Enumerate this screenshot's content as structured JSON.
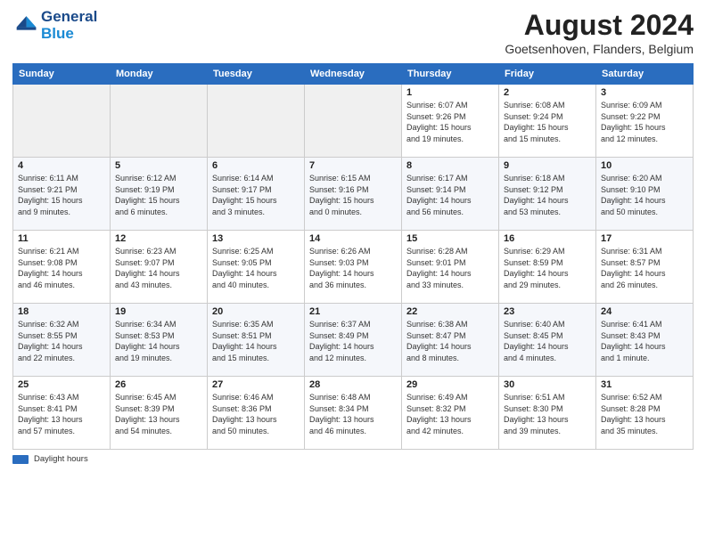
{
  "logo": {
    "line1": "General",
    "line2": "Blue"
  },
  "title": "August 2024",
  "location": "Goetsenhoven, Flanders, Belgium",
  "days_of_week": [
    "Sunday",
    "Monday",
    "Tuesday",
    "Wednesday",
    "Thursday",
    "Friday",
    "Saturday"
  ],
  "footer_label": "Daylight hours",
  "weeks": [
    [
      {
        "day": "",
        "info": ""
      },
      {
        "day": "",
        "info": ""
      },
      {
        "day": "",
        "info": ""
      },
      {
        "day": "",
        "info": ""
      },
      {
        "day": "1",
        "info": "Sunrise: 6:07 AM\nSunset: 9:26 PM\nDaylight: 15 hours\nand 19 minutes."
      },
      {
        "day": "2",
        "info": "Sunrise: 6:08 AM\nSunset: 9:24 PM\nDaylight: 15 hours\nand 15 minutes."
      },
      {
        "day": "3",
        "info": "Sunrise: 6:09 AM\nSunset: 9:22 PM\nDaylight: 15 hours\nand 12 minutes."
      }
    ],
    [
      {
        "day": "4",
        "info": "Sunrise: 6:11 AM\nSunset: 9:21 PM\nDaylight: 15 hours\nand 9 minutes."
      },
      {
        "day": "5",
        "info": "Sunrise: 6:12 AM\nSunset: 9:19 PM\nDaylight: 15 hours\nand 6 minutes."
      },
      {
        "day": "6",
        "info": "Sunrise: 6:14 AM\nSunset: 9:17 PM\nDaylight: 15 hours\nand 3 minutes."
      },
      {
        "day": "7",
        "info": "Sunrise: 6:15 AM\nSunset: 9:16 PM\nDaylight: 15 hours\nand 0 minutes."
      },
      {
        "day": "8",
        "info": "Sunrise: 6:17 AM\nSunset: 9:14 PM\nDaylight: 14 hours\nand 56 minutes."
      },
      {
        "day": "9",
        "info": "Sunrise: 6:18 AM\nSunset: 9:12 PM\nDaylight: 14 hours\nand 53 minutes."
      },
      {
        "day": "10",
        "info": "Sunrise: 6:20 AM\nSunset: 9:10 PM\nDaylight: 14 hours\nand 50 minutes."
      }
    ],
    [
      {
        "day": "11",
        "info": "Sunrise: 6:21 AM\nSunset: 9:08 PM\nDaylight: 14 hours\nand 46 minutes."
      },
      {
        "day": "12",
        "info": "Sunrise: 6:23 AM\nSunset: 9:07 PM\nDaylight: 14 hours\nand 43 minutes."
      },
      {
        "day": "13",
        "info": "Sunrise: 6:25 AM\nSunset: 9:05 PM\nDaylight: 14 hours\nand 40 minutes."
      },
      {
        "day": "14",
        "info": "Sunrise: 6:26 AM\nSunset: 9:03 PM\nDaylight: 14 hours\nand 36 minutes."
      },
      {
        "day": "15",
        "info": "Sunrise: 6:28 AM\nSunset: 9:01 PM\nDaylight: 14 hours\nand 33 minutes."
      },
      {
        "day": "16",
        "info": "Sunrise: 6:29 AM\nSunset: 8:59 PM\nDaylight: 14 hours\nand 29 minutes."
      },
      {
        "day": "17",
        "info": "Sunrise: 6:31 AM\nSunset: 8:57 PM\nDaylight: 14 hours\nand 26 minutes."
      }
    ],
    [
      {
        "day": "18",
        "info": "Sunrise: 6:32 AM\nSunset: 8:55 PM\nDaylight: 14 hours\nand 22 minutes."
      },
      {
        "day": "19",
        "info": "Sunrise: 6:34 AM\nSunset: 8:53 PM\nDaylight: 14 hours\nand 19 minutes."
      },
      {
        "day": "20",
        "info": "Sunrise: 6:35 AM\nSunset: 8:51 PM\nDaylight: 14 hours\nand 15 minutes."
      },
      {
        "day": "21",
        "info": "Sunrise: 6:37 AM\nSunset: 8:49 PM\nDaylight: 14 hours\nand 12 minutes."
      },
      {
        "day": "22",
        "info": "Sunrise: 6:38 AM\nSunset: 8:47 PM\nDaylight: 14 hours\nand 8 minutes."
      },
      {
        "day": "23",
        "info": "Sunrise: 6:40 AM\nSunset: 8:45 PM\nDaylight: 14 hours\nand 4 minutes."
      },
      {
        "day": "24",
        "info": "Sunrise: 6:41 AM\nSunset: 8:43 PM\nDaylight: 14 hours\nand 1 minute."
      }
    ],
    [
      {
        "day": "25",
        "info": "Sunrise: 6:43 AM\nSunset: 8:41 PM\nDaylight: 13 hours\nand 57 minutes."
      },
      {
        "day": "26",
        "info": "Sunrise: 6:45 AM\nSunset: 8:39 PM\nDaylight: 13 hours\nand 54 minutes."
      },
      {
        "day": "27",
        "info": "Sunrise: 6:46 AM\nSunset: 8:36 PM\nDaylight: 13 hours\nand 50 minutes."
      },
      {
        "day": "28",
        "info": "Sunrise: 6:48 AM\nSunset: 8:34 PM\nDaylight: 13 hours\nand 46 minutes."
      },
      {
        "day": "29",
        "info": "Sunrise: 6:49 AM\nSunset: 8:32 PM\nDaylight: 13 hours\nand 42 minutes."
      },
      {
        "day": "30",
        "info": "Sunrise: 6:51 AM\nSunset: 8:30 PM\nDaylight: 13 hours\nand 39 minutes."
      },
      {
        "day": "31",
        "info": "Sunrise: 6:52 AM\nSunset: 8:28 PM\nDaylight: 13 hours\nand 35 minutes."
      }
    ]
  ]
}
